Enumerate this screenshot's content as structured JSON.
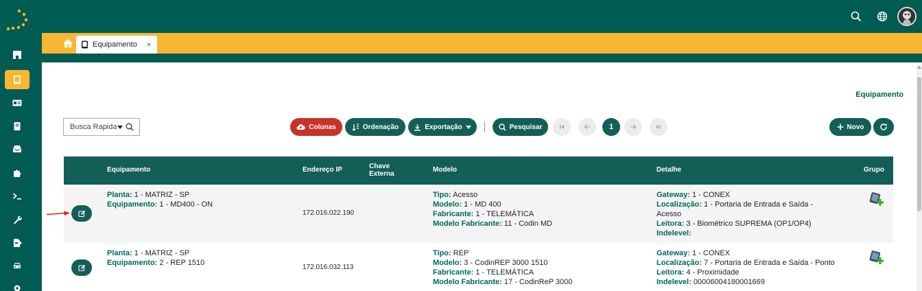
{
  "nav": {
    "items": [
      {
        "name": "sidebar-item-home",
        "icon": "building-icon"
      },
      {
        "name": "sidebar-item-equipment",
        "icon": "tablet-icon",
        "active": true
      },
      {
        "name": "sidebar-item-card",
        "icon": "id-card-icon"
      },
      {
        "name": "sidebar-item-book",
        "icon": "book-icon"
      },
      {
        "name": "sidebar-item-inbox",
        "icon": "inbox-icon"
      },
      {
        "name": "sidebar-item-plugins",
        "icon": "puzzle-icon"
      },
      {
        "name": "sidebar-item-terminal",
        "icon": "terminal-icon"
      },
      {
        "name": "sidebar-item-tools",
        "icon": "wrench-icon"
      },
      {
        "name": "sidebar-item-export",
        "icon": "file-export-icon"
      },
      {
        "name": "sidebar-item-vehicle",
        "icon": "car-icon"
      },
      {
        "name": "sidebar-item-settings",
        "icon": "gear-icon"
      }
    ]
  },
  "tabs": [
    {
      "label": "Equipamento",
      "close": "×"
    }
  ],
  "page": {
    "heading": "Equipamento"
  },
  "toolbar": {
    "search_placeholder": "Busca Rapida",
    "columns_label": "Colunas",
    "order_label": "Ordenação",
    "export_label": "Exportação",
    "search_label": "Pesquisar",
    "current_page": "1",
    "new_label": "Novo"
  },
  "table": {
    "headers": {
      "equipment": "Equipamento",
      "ip": "Endereço IP",
      "key_line1": "Chave",
      "key_line2": "Externa",
      "model": "Modelo",
      "detail": "Detalhe",
      "group": "Grupo"
    },
    "labels": {
      "plant": "Planta:",
      "equipment": "Equipamento:",
      "type": "Tipo:",
      "model": "Modelo:",
      "manufacturer": "Fabricante:",
      "manufacturer_model": "Modelo Fabricante:",
      "gateway": "Gateway:",
      "location": "Localização:",
      "reader": "Leitora:",
      "indelevel": "Indelevel:"
    },
    "rows": [
      {
        "plant": "1 - MATRIZ - SP",
        "equipment": "1 - MD400 - ON",
        "ip": "172.016.022.190",
        "type": "Acesso",
        "model": "1 - MD 400",
        "manufacturer": "1 - TELEMÁTICA",
        "manufacturer_model": "11 - Codin MD",
        "gateway": "1 - CONEX",
        "location_l1": "1 - Portaria de Entrada e Saída -",
        "location_l2": "Acesso",
        "reader": "3 - Biométrico SUPREMA (OP1/OP4)",
        "indelevel": ""
      },
      {
        "plant": "1 - MATRIZ - SP",
        "equipment": "2 - REP 1510",
        "ip": "172.016.032.113",
        "type": "REP",
        "model": "3 - CodinREP 3000 1510",
        "manufacturer": "1 - TELEMÁTICA",
        "manufacturer_model": "17 - CodinReP 3000",
        "gateway": "1 - CONEX",
        "location_l1": "7 - Portaria de Entrada e Saída - Ponto",
        "reader": "4 - Proximidade",
        "indelevel": "00006004180001669"
      }
    ]
  },
  "colors": {
    "primary": "#005b52",
    "accent": "#f7b733",
    "danger": "#c8322c",
    "label": "#00695c"
  }
}
